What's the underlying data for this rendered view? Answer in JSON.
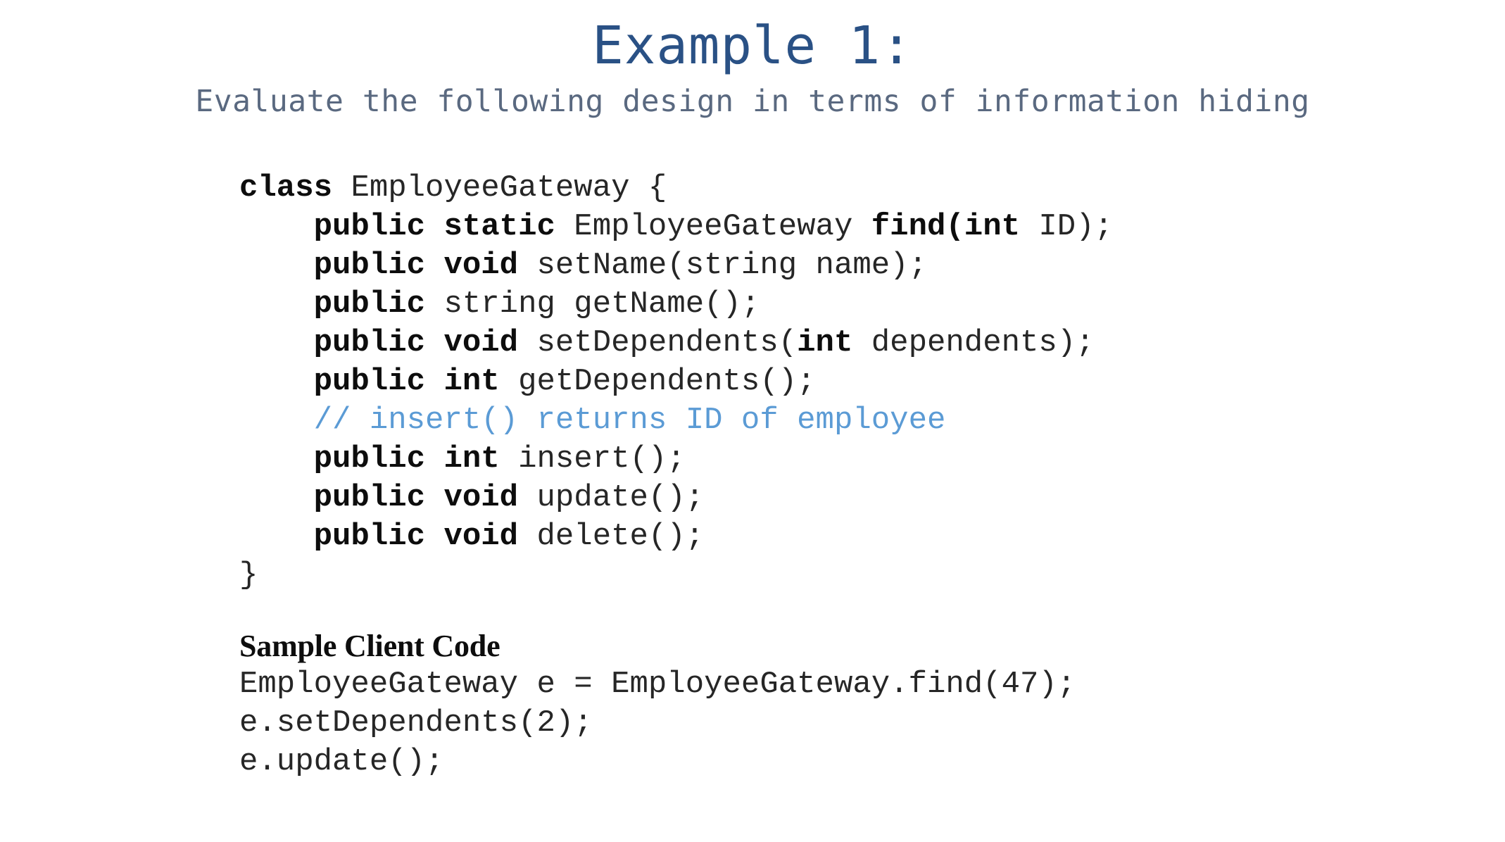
{
  "slide": {
    "title": "Example 1:",
    "subtitle": "Evaluate the following design in terms of information hiding",
    "title_color": "#2A5185",
    "subtitle_color": "#5A6980",
    "comment_color": "#5B9BD5",
    "background_color": "#FFFFFF"
  },
  "code": {
    "lines": [
      {
        "indent": 0,
        "tokens": [
          {
            "t": "class ",
            "b": true
          },
          {
            "t": "EmployeeGateway {",
            "b": false
          }
        ]
      },
      {
        "indent": 1,
        "tokens": [
          {
            "t": "public static ",
            "b": true
          },
          {
            "t": "EmployeeGateway ",
            "b": false
          },
          {
            "t": "find(int ",
            "b": true
          },
          {
            "t": "ID);",
            "b": false
          }
        ]
      },
      {
        "indent": 1,
        "tokens": [
          {
            "t": "public void ",
            "b": true
          },
          {
            "t": "setName(string name);",
            "b": false
          }
        ]
      },
      {
        "indent": 1,
        "tokens": [
          {
            "t": "public ",
            "b": true
          },
          {
            "t": "string getName();",
            "b": false
          }
        ]
      },
      {
        "indent": 1,
        "tokens": [
          {
            "t": "public void ",
            "b": true
          },
          {
            "t": "setDependents(",
            "b": false
          },
          {
            "t": "int ",
            "b": true
          },
          {
            "t": "dependents);",
            "b": false
          }
        ]
      },
      {
        "indent": 1,
        "tokens": [
          {
            "t": "public int ",
            "b": true
          },
          {
            "t": "getDependents();",
            "b": false
          }
        ]
      },
      {
        "indent": 1,
        "comment": true,
        "tokens": [
          {
            "t": "// insert() returns ID of employee",
            "b": false
          }
        ]
      },
      {
        "indent": 1,
        "tokens": [
          {
            "t": "public int ",
            "b": true
          },
          {
            "t": "insert();",
            "b": false
          }
        ]
      },
      {
        "indent": 1,
        "tokens": [
          {
            "t": "public void ",
            "b": true
          },
          {
            "t": "update();",
            "b": false
          }
        ]
      },
      {
        "indent": 1,
        "tokens": [
          {
            "t": "public void ",
            "b": true
          },
          {
            "t": "delete();",
            "b": false
          }
        ]
      },
      {
        "indent": 0,
        "tokens": [
          {
            "t": "}",
            "b": false
          }
        ]
      }
    ],
    "plain_text": [
      "class EmployeeGateway {",
      "    public static EmployeeGateway find(int ID);",
      "    public void setName(string name);",
      "    public string getName();",
      "    public void setDependents(int dependents);",
      "    public int getDependents();",
      "    // insert() returns ID of employee",
      "    public int insert();",
      "    public void update();",
      "    public void delete();",
      "}"
    ]
  },
  "sample": {
    "heading": "Sample Client Code",
    "lines": [
      "EmployeeGateway e = EmployeeGateway.find(47);",
      "e.setDependents(2);",
      "e.update();"
    ]
  }
}
